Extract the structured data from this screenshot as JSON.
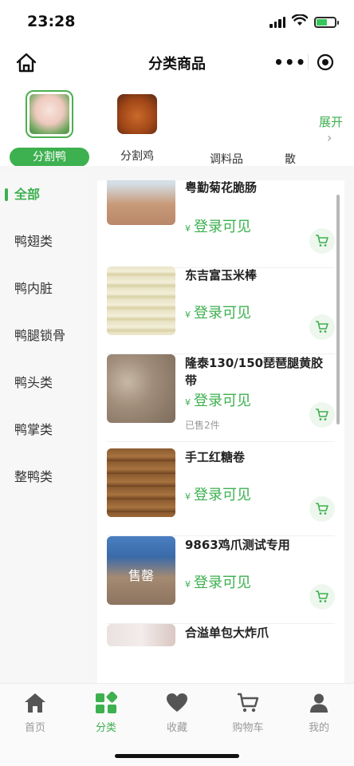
{
  "status": {
    "time": "23:28"
  },
  "nav": {
    "title": "分类商品"
  },
  "categories": [
    {
      "label": "分割鸭",
      "active": true
    },
    {
      "label": "分割鸡",
      "active": false
    },
    {
      "label": "调料品",
      "active": false
    },
    {
      "label": "散",
      "active": false
    }
  ],
  "expand_label": "展开",
  "sidebar": {
    "items": [
      "全部",
      "鸭翅类",
      "鸭内脏",
      "鸭腿锁骨",
      "鸭头类",
      "鸭掌类",
      "整鸭类"
    ]
  },
  "products": [
    {
      "name": "粤勤菊花脆肠",
      "price_label": "登录可见",
      "sold": ""
    },
    {
      "name": "东吉富玉米棒",
      "price_label": "登录可见",
      "sold": ""
    },
    {
      "name": "隆泰130/150琵琶腿黄胶带",
      "price_label": "登录可见",
      "sold": "已售2件"
    },
    {
      "name": "手工红糖卷",
      "price_label": "登录可见",
      "sold": ""
    },
    {
      "name": "9863鸡爪测试专用",
      "price_label": "登录可见",
      "sold": "",
      "overlay": "售罄"
    },
    {
      "name": "合溢单包大炸爪",
      "price_label": "",
      "sold": ""
    }
  ],
  "currency_symbol": "¥",
  "tabbar": [
    {
      "label": "首页",
      "icon": "home-icon"
    },
    {
      "label": "分类",
      "icon": "category-icon"
    },
    {
      "label": "收藏",
      "icon": "heart-icon"
    },
    {
      "label": "购物车",
      "icon": "cart-icon"
    },
    {
      "label": "我的",
      "icon": "user-icon"
    }
  ],
  "colors": {
    "accent": "#3db04f",
    "accent_light": "#eef7ee",
    "muted": "#999999"
  }
}
